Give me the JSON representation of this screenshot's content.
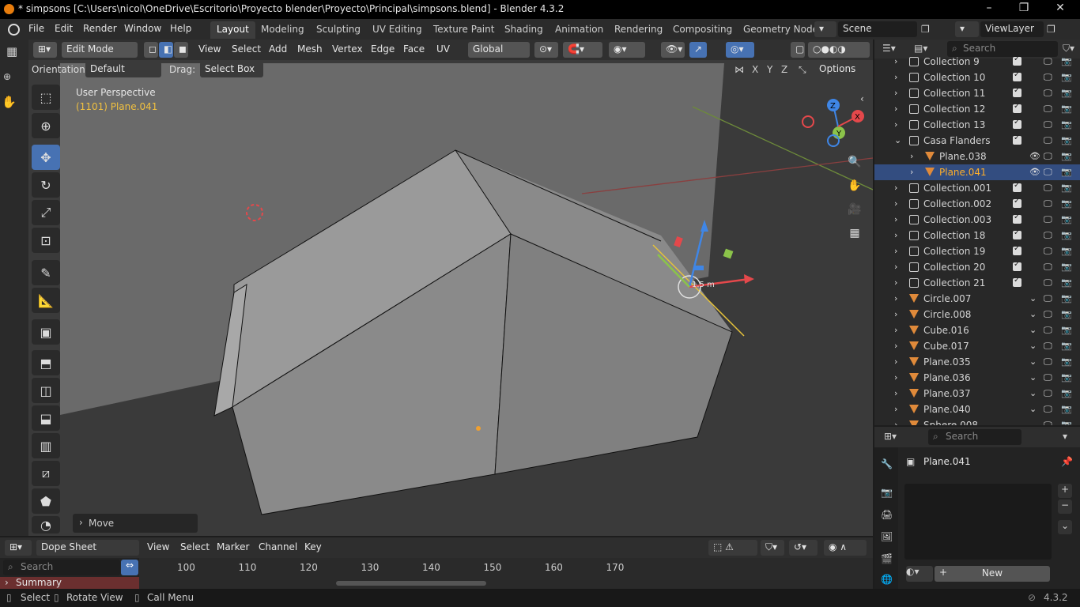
{
  "window": {
    "title": "* simpsons [C:\\Users\\nicol\\OneDrive\\Escritorio\\Proyecto blender\\Proyecto\\Principal\\simpsons.blend] - Blender 4.3.2",
    "minimize": "–",
    "maximize": "❐",
    "close": "✕"
  },
  "menu": [
    "File",
    "Edit",
    "Render",
    "Window",
    "Help"
  ],
  "workspaces": [
    "Layout",
    "Modeling",
    "Sculpting",
    "UV Editing",
    "Texture Paint",
    "Shading",
    "Animation",
    "Rendering",
    "Compositing",
    "Geometry Node"
  ],
  "active_workspace": "Layout",
  "scene": "Scene",
  "view_layer": "ViewLayer",
  "viewport": {
    "mode": "Edit Mode",
    "menus": [
      "View",
      "Select",
      "Add",
      "Mesh",
      "Vertex",
      "Edge",
      "Face",
      "UV"
    ],
    "transform_orientation": "Global",
    "orientation_label": "Orientation:",
    "orientation_value": "Default",
    "drag_label": "Drag:",
    "drag_value": "Select Box",
    "axes": [
      "X",
      "Y",
      "Z"
    ],
    "options": "Options",
    "perspective": "User Perspective",
    "object_info": "(1101) Plane.041",
    "operator_panel": "Move",
    "measure": "1.5 m",
    "gizmo_axes": [
      "X",
      "Y",
      "Z"
    ]
  },
  "outliner": {
    "search_placeholder": "Search",
    "rows": [
      {
        "label": "Collection 9",
        "type": "collection"
      },
      {
        "label": "Collection 10",
        "type": "collection"
      },
      {
        "label": "Collection 11",
        "type": "collection"
      },
      {
        "label": "Collection 12",
        "type": "collection"
      },
      {
        "label": "Collection 13",
        "type": "collection"
      },
      {
        "label": "Casa Flanders",
        "type": "collection"
      },
      {
        "label": "Plane.038",
        "type": "mesh"
      },
      {
        "label": "Plane.041",
        "type": "mesh"
      },
      {
        "label": "Collection.001",
        "type": "collection"
      },
      {
        "label": "Collection.002",
        "type": "collection"
      },
      {
        "label": "Collection.003",
        "type": "collection"
      },
      {
        "label": "Collection 18",
        "type": "collection"
      },
      {
        "label": "Collection 19",
        "type": "collection"
      },
      {
        "label": "Collection 20",
        "type": "collection"
      },
      {
        "label": "Collection 21",
        "type": "collection"
      },
      {
        "label": "Circle.007",
        "type": "mesh"
      },
      {
        "label": "Circle.008",
        "type": "mesh"
      },
      {
        "label": "Cube.016",
        "type": "mesh"
      },
      {
        "label": "Cube.017",
        "type": "mesh"
      },
      {
        "label": "Plane.035",
        "type": "mesh"
      },
      {
        "label": "Plane.036",
        "type": "mesh"
      },
      {
        "label": "Plane.037",
        "type": "mesh"
      },
      {
        "label": "Plane.040",
        "type": "mesh"
      },
      {
        "label": "Sphere.008",
        "type": "mesh"
      }
    ]
  },
  "properties": {
    "search_placeholder": "Search",
    "object": "Plane.041",
    "new_button": "New"
  },
  "dopesheet": {
    "editor": "Dope Sheet",
    "menus": [
      "View",
      "Select",
      "Marker",
      "Channel",
      "Key"
    ],
    "search_placeholder": "Search",
    "frames": [
      "100",
      "110",
      "120",
      "130",
      "140",
      "150",
      "160",
      "170"
    ],
    "summary": "Summary"
  },
  "status": {
    "items": [
      "Select",
      "Rotate View",
      "Call Menu"
    ],
    "version": "4.3.2"
  },
  "colors": {
    "accent": "#4772b3",
    "selected_text": "#ffaf29",
    "x_axis": "#e4484b",
    "y_axis": "#8bc34a",
    "z_axis": "#3f86e6"
  }
}
